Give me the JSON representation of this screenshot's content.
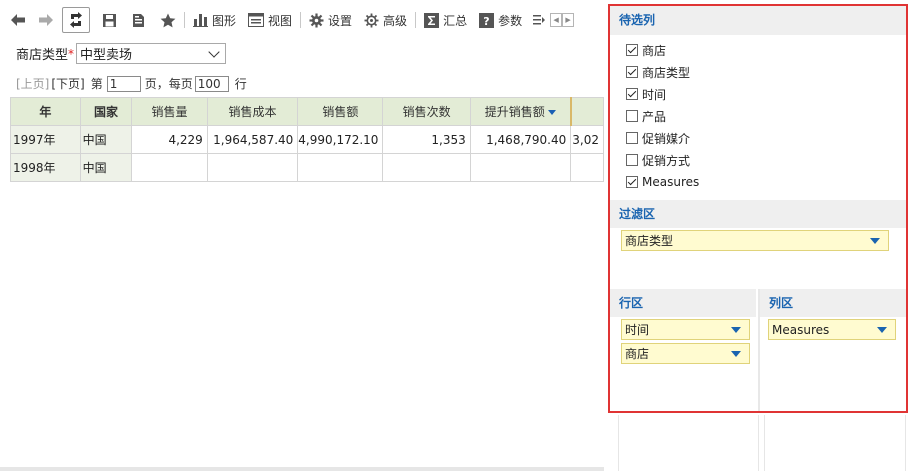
{
  "toolbar": {
    "back_icon": "arrow-left-icon",
    "forward_icon": "arrow-right-icon",
    "refresh_icon": "refresh-icon",
    "save_icon": "save-icon",
    "save_as_icon": "save-as-icon",
    "favorite_icon": "star-icon",
    "chart_label": "图形",
    "view_label": "视图",
    "settings_label": "设置",
    "advanced_label": "高级",
    "summary_label": "汇总",
    "params_label": "参数"
  },
  "filter": {
    "label": "商店类型",
    "required_mark": "*",
    "value": "中型卖场"
  },
  "pager": {
    "prev": "[上页]",
    "next": "[下页]",
    "page_prefix": "第",
    "page_value": "1",
    "page_suffix": "页，每页",
    "size_value": "100",
    "size_suffix": "行"
  },
  "table": {
    "headers": [
      "年",
      "国家",
      "销售量",
      "销售成本",
      "销售额",
      "销售次数",
      "提升销售额",
      ""
    ],
    "rows": [
      [
        "1997年",
        "中国",
        "4,229",
        "1,964,587.40",
        "4,990,172.10",
        "1,353",
        "1,468,790.40",
        "3,02"
      ],
      [
        "1998年",
        "中国",
        "",
        "",
        "",
        "",
        "",
        ""
      ]
    ]
  },
  "panel": {
    "candidates_title": "待选列",
    "candidates": [
      {
        "label": "商店",
        "checked": true
      },
      {
        "label": "商店类型",
        "checked": true
      },
      {
        "label": "时间",
        "checked": true
      },
      {
        "label": "产品",
        "checked": false
      },
      {
        "label": "促销媒介",
        "checked": false
      },
      {
        "label": "促销方式",
        "checked": false
      },
      {
        "label": "Measures",
        "checked": true
      }
    ],
    "filter_title": "过滤区",
    "filter_chip": "商店类型",
    "row_title": "行区",
    "row_chips": [
      "时间",
      "商店"
    ],
    "col_title": "列区",
    "col_chips": [
      "Measures"
    ]
  },
  "colors": {
    "header_bg": "#e3ecd6",
    "dim_bg": "#eef2e8",
    "panel_border": "#e03434",
    "section_title": "#1a64b0",
    "chip_bg": "#fffbd0"
  }
}
